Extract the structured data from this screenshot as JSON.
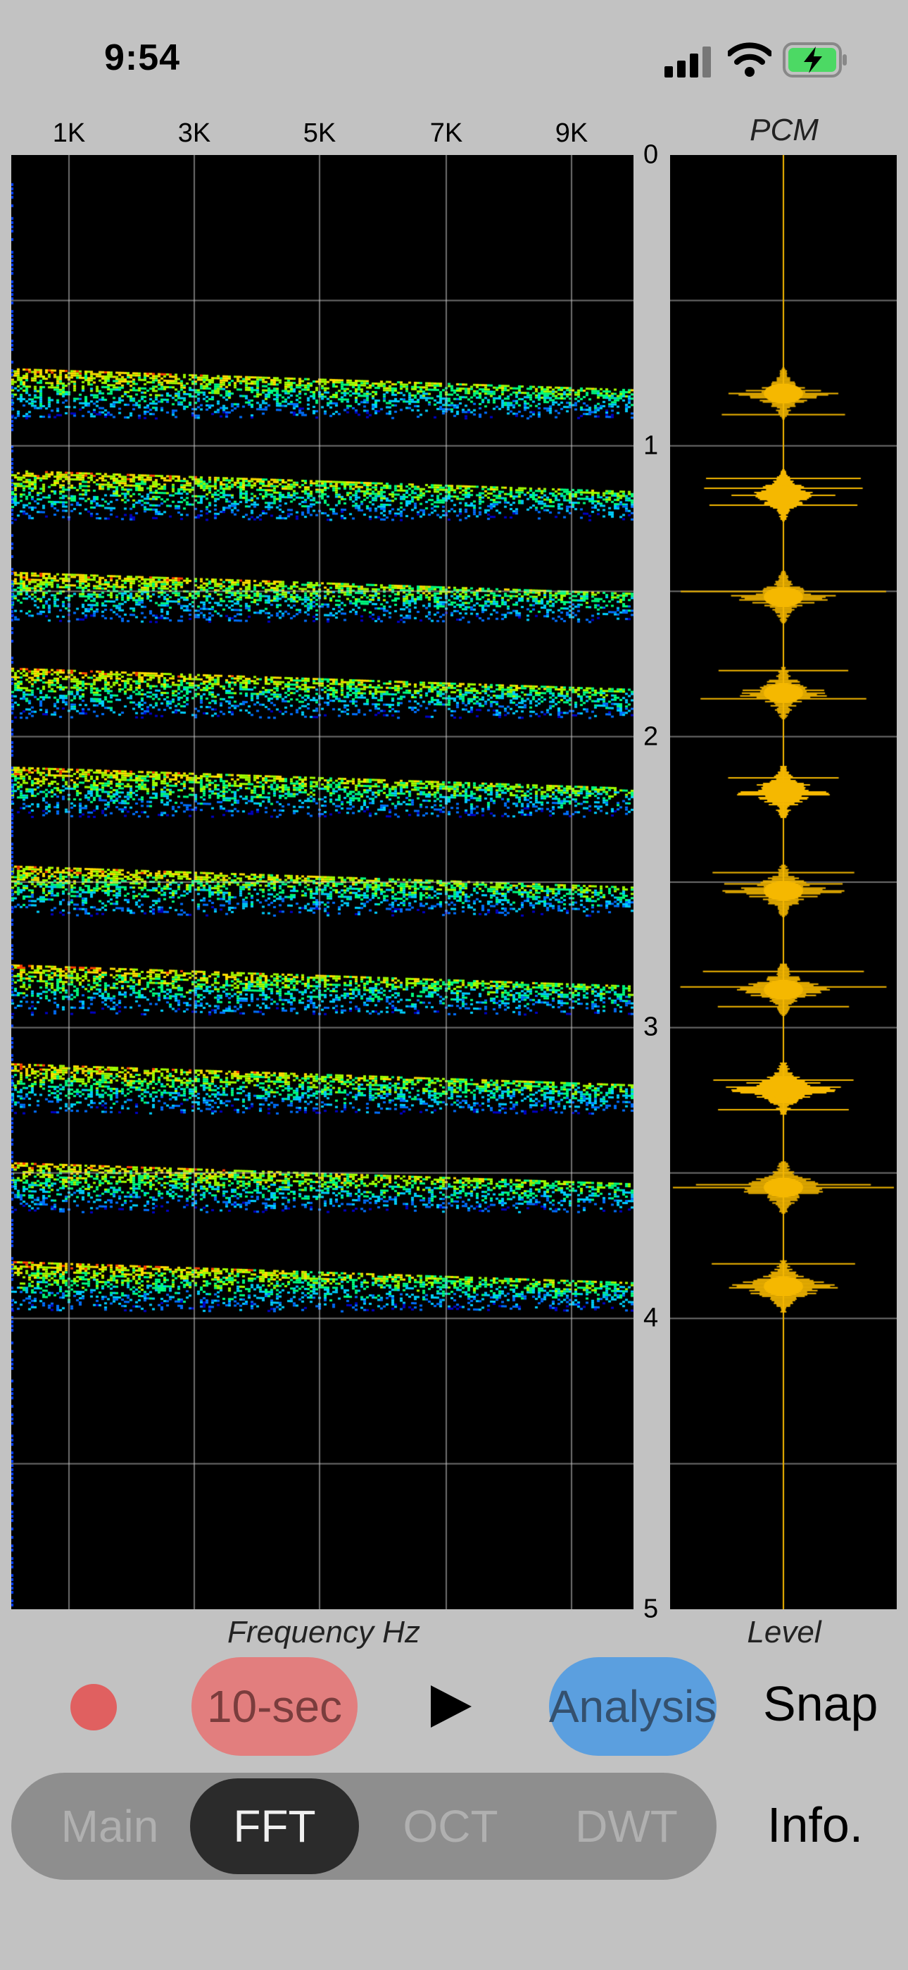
{
  "status_bar": {
    "time": "9:54",
    "icons": [
      "signal-icon",
      "wifi-icon",
      "battery-charging-icon"
    ],
    "battery_color": "#4cd964"
  },
  "spectrogram": {
    "x_ticks": [
      "1K",
      "3K",
      "5K",
      "7K",
      "9K"
    ],
    "x_label": "Frequency Hz",
    "y_ticks": [
      "0",
      "1",
      "2",
      "3",
      "4",
      "5"
    ],
    "palette": [
      "#0000c8",
      "#0070ff",
      "#00d0ff",
      "#00ff80",
      "#a0ff00",
      "#ffe000",
      "#ff4000"
    ],
    "event_times": [
      0.82,
      1.17,
      1.52,
      1.85,
      2.19,
      2.53,
      2.87,
      3.21,
      3.55,
      3.89
    ]
  },
  "pcm": {
    "title": "PCM",
    "label": "Level",
    "waveform_color": "#f5b800"
  },
  "controls": {
    "record_color": "#e06060",
    "duration_label": "10-sec",
    "play_icon": "play-icon",
    "analysis_label": "Analysis",
    "snap_label": "Snap"
  },
  "tabs": {
    "items": [
      {
        "label": "Main"
      },
      {
        "label": "FFT"
      },
      {
        "label": "OCT"
      },
      {
        "label": "DWT"
      }
    ],
    "selected": "FFT",
    "info_label": "Info."
  }
}
